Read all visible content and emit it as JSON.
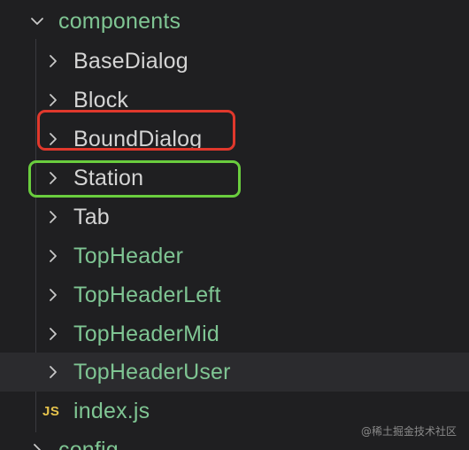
{
  "explorer": {
    "root": {
      "label": "components",
      "expanded": true,
      "color": "#7fc593"
    },
    "items": [
      {
        "label": "BaseDialog",
        "type": "folder",
        "color": "#d4d4d4"
      },
      {
        "label": "Block",
        "type": "folder",
        "color": "#d4d4d4"
      },
      {
        "label": "BoundDialog",
        "type": "folder",
        "color": "#d4d4d4",
        "annotation": "red-box"
      },
      {
        "label": "Station",
        "type": "folder",
        "color": "#d4d4d4",
        "annotation": "green-box"
      },
      {
        "label": "Tab",
        "type": "folder",
        "color": "#d4d4d4"
      },
      {
        "label": "TopHeader",
        "type": "folder",
        "color": "#7fc593"
      },
      {
        "label": "TopHeaderLeft",
        "type": "folder",
        "color": "#7fc593"
      },
      {
        "label": "TopHeaderMid",
        "type": "folder",
        "color": "#7fc593"
      },
      {
        "label": "TopHeaderUser",
        "type": "folder",
        "color": "#7fc593",
        "hovered": true
      },
      {
        "label": "index.js",
        "type": "file",
        "badge": "JS",
        "color": "#7fc593"
      }
    ],
    "next_root": {
      "label": "config",
      "expanded": false,
      "color": "#7fc593"
    }
  },
  "watermark": "@稀土掘金技术社区",
  "colors": {
    "background": "#1f1f21",
    "hover_row": "#2b2b2e",
    "modified_green": "#7fc593",
    "default_text": "#d4d4d4",
    "js_badge": "#e6c34c",
    "annotation_red": "#e0382c",
    "annotation_green": "#6acd3e"
  }
}
